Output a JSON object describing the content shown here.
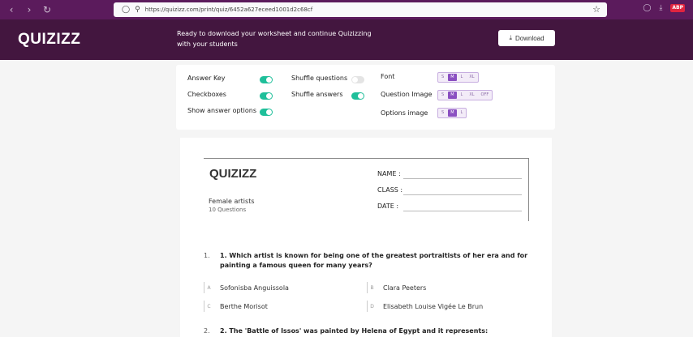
{
  "browser": {
    "url": "https://quizizz.com/print/quiz/6452a627eceed1001d2c68cf"
  },
  "header": {
    "logo": "QUIZIZZ",
    "banner": "Ready to download your worksheet and continue Quizizzing with your students",
    "download_label": "Download"
  },
  "settings": {
    "answer_key": "Answer Key",
    "checkboxes": "Checkboxes",
    "show_answer_options": "Show answer options",
    "shuffle_questions": "Shuffle questions",
    "shuffle_answers": "Shuffle answers",
    "font": "Font",
    "question_image": "Question Image",
    "options_image": "Options image",
    "font_sizes": [
      "S",
      "M",
      "L",
      "XL"
    ],
    "question_image_sizes": [
      "S",
      "M",
      "L",
      "XL",
      "OFF"
    ],
    "options_image_sizes": [
      "S",
      "M",
      "L"
    ],
    "selected_size": "M"
  },
  "sheet": {
    "logo": "QUIZIZZ",
    "title": "Female artists",
    "count": "10 Questions",
    "name_label": "NAME :",
    "class_label": "CLASS :",
    "date_label": "DATE  :"
  },
  "questions": [
    {
      "number": "1.",
      "text": "1.   Which artist is known for being one of the greatest portraitists of her era and for painting a famous queen for many years?",
      "options": [
        {
          "letter": "A",
          "text": "Sofonisba Anguissola"
        },
        {
          "letter": "B",
          "text": "Clara Peeters"
        },
        {
          "letter": "C",
          "text": "Berthe Morisot"
        },
        {
          "letter": "D",
          "text": "Elisabeth Louise Vigée Le Brun"
        }
      ]
    },
    {
      "number": "2.",
      "text": "2.   The 'Battle of Issos' was painted by Helena of Egypt and it represents:"
    }
  ]
}
